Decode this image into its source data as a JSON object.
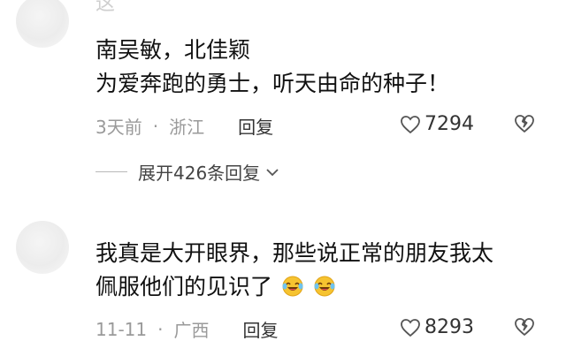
{
  "comments": [
    {
      "username_partial": "这",
      "lines": [
        "南吴敏，北佳颖",
        "为爱奔跑的勇士，听天由命的种子！"
      ],
      "time": "3天前",
      "separator": "·",
      "location": "浙江",
      "reply_label": "回复",
      "likes": "7294",
      "expand_label": "展开426条回复"
    },
    {
      "lines": [
        "我真是大开眼界，那些说正常的朋友我太",
        "佩服他们的见识了"
      ],
      "emoji": [
        "laughing-crying-emoji",
        "laughing-crying-emoji"
      ],
      "time": "11-11",
      "separator": "·",
      "location": "广西",
      "reply_label": "回复",
      "likes": "8293"
    }
  ],
  "colors": {
    "text": "#111111",
    "meta": "#9a9a9a",
    "emoji_face": "#f6c330",
    "emoji_tears": "#6ec3f0"
  }
}
